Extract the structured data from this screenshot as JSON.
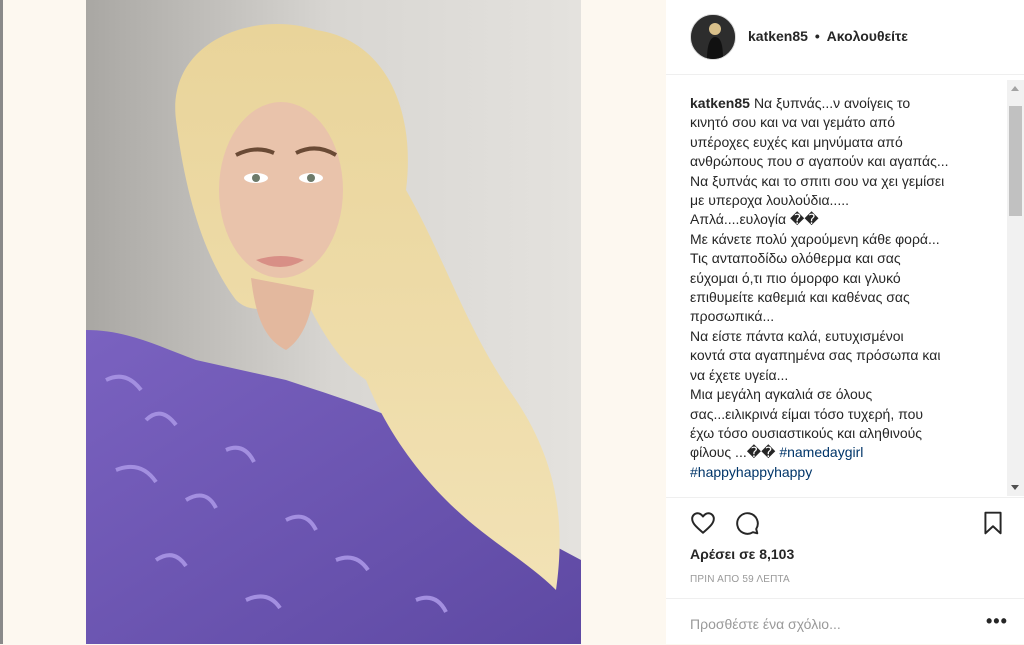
{
  "post": {
    "username": "katken85",
    "separator": "•",
    "follow_status": "Ακολουθείτε"
  },
  "caption": {
    "username": "katken85",
    "lines": [
      "Να ξυπνάς...ν ανοίγεις το",
      "κινητό σου και να ναι γεμάτο από",
      "υπέροχες ευχές και μηνύματα από",
      "ανθρώπους που σ αγαπούν και αγαπάς...",
      "Να ξυπνάς και το σπιτι σου να χει γεμίσει",
      "με υπεροχα λουλούδια.....",
      "Απλά....ευλογία ��",
      "Με κάνετε πολύ χαρούμενη κάθε φορά...",
      "Τις ανταποδίδω ολόθερμα και σας",
      "εύχομαι ό,τι πιο όμορφο και γλυκό",
      "επιθυμείτε καθεμιά και καθένας σας",
      "προσωπικά...",
      "Να είστε πάντα καλά, ευτυχισμένοι",
      "κοντά στα αγαπημένα σας πρόσωπα και",
      "να έχετε υγεία...",
      "Μια μεγάλη αγκαλιά σε όλους",
      "σας...ειλικρινά είμαι τόσο τυχερή, που",
      "έχω τόσο ουσιαστικούς και αληθινούς"
    ],
    "last_line_prefix": "φίλους ...�� ",
    "hashtags": [
      "#namedaygirl",
      "#happyhappyhappy"
    ]
  },
  "icons": {
    "like": "heart-icon",
    "comment": "comment-icon",
    "save": "bookmark-icon",
    "more": "more-options-icon"
  },
  "likes_text": "Αρέσει σε 8,103",
  "timestamp": "ΠΡΙΝ ΑΠΟ 59 ΛΕΠΤΑ",
  "comment": {
    "placeholder": "Προσθέστε ένα σχόλιο...",
    "more_label": "•••"
  }
}
